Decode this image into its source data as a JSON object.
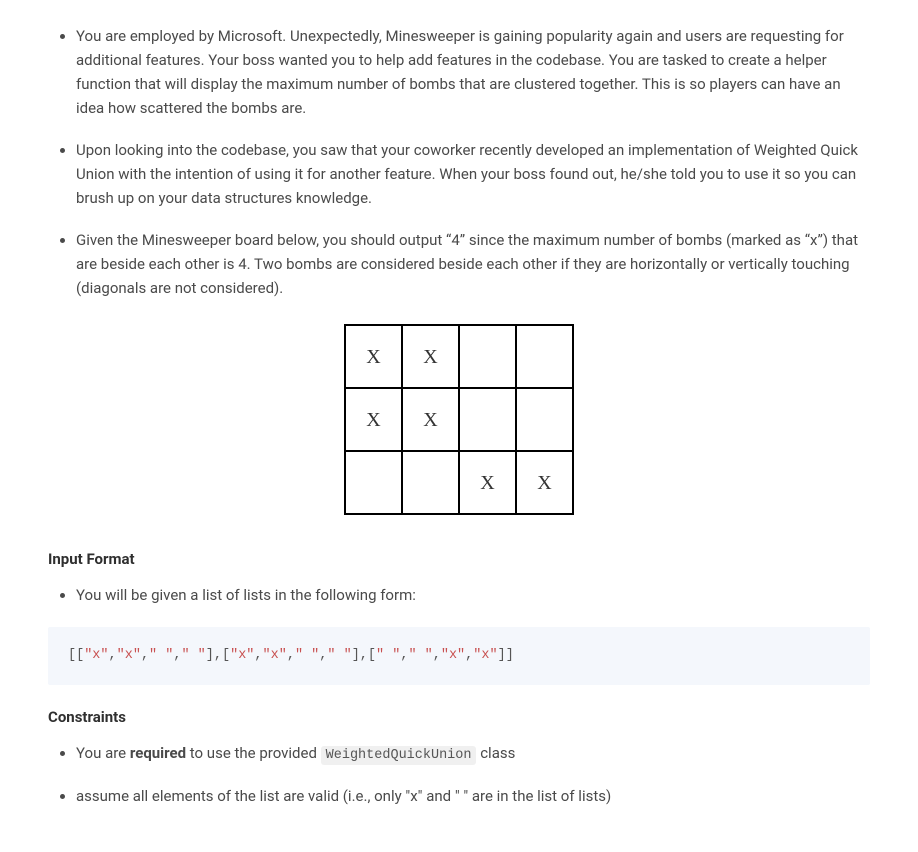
{
  "bullets_intro": [
    "You are employed by Microsoft. Unexpectedly, Minesweeper is gaining popularity again and users are requesting for additional features. Your boss wanted you to help add features in the codebase. You are tasked to create a helper function that will display the maximum number of bombs that are clustered together. This is so players can have an idea how scattered the bombs are.",
    "Upon looking into the codebase, you saw that your coworker recently developed an implementation of Weighted Quick Union with the intention of using it for another feature. When your boss found out, he/she told you to use it so you can brush up on your data structures knowledge.",
    "Given the Minesweeper board below, you should output “4” since the maximum number of bombs (marked as “x”) that are beside each other is 4. Two bombs are considered beside each other if they are horizontally or vertically touching (diagonals are not considered)."
  ],
  "board": {
    "rows": [
      [
        "X",
        "X",
        "",
        ""
      ],
      [
        "X",
        "X",
        "",
        ""
      ],
      [
        "",
        "",
        "X",
        "X"
      ]
    ]
  },
  "input_format": {
    "heading": "Input Format",
    "bullet": "You will be given a list of lists in the following form:"
  },
  "code_sample": {
    "tokens": [
      {
        "t": "brack",
        "v": "[["
      },
      {
        "t": "str",
        "v": "\"x\""
      },
      {
        "t": "punc",
        "v": ","
      },
      {
        "t": "str",
        "v": "\"x\""
      },
      {
        "t": "punc",
        "v": ","
      },
      {
        "t": "str",
        "v": "\" \""
      },
      {
        "t": "punc",
        "v": ","
      },
      {
        "t": "str",
        "v": "\" \""
      },
      {
        "t": "brack",
        "v": "]"
      },
      {
        "t": "punc",
        "v": ","
      },
      {
        "t": "brack",
        "v": "["
      },
      {
        "t": "str",
        "v": "\"x\""
      },
      {
        "t": "punc",
        "v": ","
      },
      {
        "t": "str",
        "v": "\"x\""
      },
      {
        "t": "punc",
        "v": ","
      },
      {
        "t": "str",
        "v": "\" \""
      },
      {
        "t": "punc",
        "v": ","
      },
      {
        "t": "str",
        "v": "\" \""
      },
      {
        "t": "brack",
        "v": "]"
      },
      {
        "t": "punc",
        "v": ","
      },
      {
        "t": "brack",
        "v": "["
      },
      {
        "t": "str",
        "v": "\" \""
      },
      {
        "t": "punc",
        "v": ","
      },
      {
        "t": "str",
        "v": "\" \""
      },
      {
        "t": "punc",
        "v": ","
      },
      {
        "t": "str",
        "v": "\"x\""
      },
      {
        "t": "punc",
        "v": ","
      },
      {
        "t": "str",
        "v": "\"x\""
      },
      {
        "t": "brack",
        "v": "]]"
      }
    ]
  },
  "constraints": {
    "heading": "Constraints",
    "item1_pre": "You are ",
    "item1_bold": "required",
    "item1_mid": " to use the provided ",
    "item1_code": "WeightedQuickUnion",
    "item1_post": " class",
    "item2": "assume all elements of the list are valid (i.e., only \"x\" and \" \" are in the list of lists)"
  }
}
